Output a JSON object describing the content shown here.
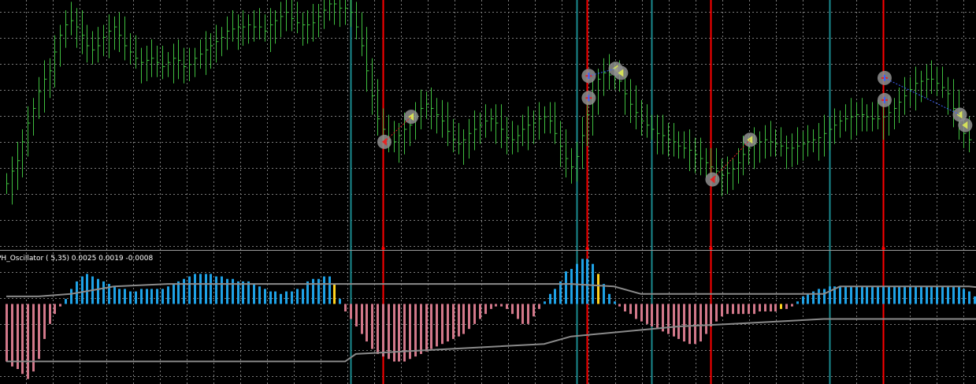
{
  "colors": {
    "background": "#000000",
    "grid": "#7a7a7a",
    "candle": "#3fbf3f",
    "vline_red": "#ff0000",
    "vline_cyan": "#1a8a8f",
    "hist_blue": "#1ea2e6",
    "hist_pink": "#d2788a",
    "hist_yellow": "#ffd21e",
    "signal_line": "#8a8a8a",
    "marker_fill": "#8f8f8f",
    "marker_red": "#e52525",
    "marker_blue": "#3a62ff",
    "marker_arrow": "#d4e05a"
  },
  "oscillator": {
    "label": "PH_Oscillator ( 5,35) 0.0025 0.0019 -0.0008"
  },
  "chart_data": [
    {
      "type": "candlestick",
      "panel": "price",
      "grid": true,
      "x_range": [
        0,
        184
      ],
      "y_range": [
        0,
        100
      ],
      "closes": [
        14,
        20,
        25,
        34,
        43,
        50,
        58,
        64,
        68,
        77,
        85,
        90,
        92,
        89,
        85,
        80,
        78,
        80,
        84,
        87,
        89,
        85,
        80,
        77,
        74,
        72,
        73,
        74,
        72,
        70,
        72,
        74,
        73,
        70,
        71,
        74,
        76,
        78,
        80,
        82,
        84,
        87,
        88,
        89,
        89,
        90,
        89,
        89,
        87,
        90,
        92,
        94,
        96,
        93,
        91,
        90,
        90,
        91,
        94,
        97,
        100,
        100,
        98,
        98,
        96,
        89,
        80,
        68,
        56,
        45,
        40,
        35,
        34,
        37,
        40,
        42,
        46,
        50,
        52,
        50,
        47,
        44,
        39,
        35,
        33,
        35,
        38,
        40,
        42,
        44,
        45,
        43,
        40,
        36,
        35,
        37,
        40,
        42,
        43,
        45,
        46,
        44,
        38,
        32,
        26,
        22,
        27,
        37,
        47,
        56,
        64,
        67,
        66,
        65,
        63,
        57,
        52,
        48,
        44,
        42,
        40,
        38,
        37,
        35,
        34,
        32,
        31,
        30,
        28,
        26,
        24,
        22,
        20,
        18,
        19,
        21,
        24,
        28,
        31,
        33,
        34,
        35,
        34,
        33,
        32,
        31,
        31,
        32,
        33,
        34,
        35,
        36,
        38,
        40,
        42,
        44,
        45,
        46,
        47,
        47,
        46,
        45,
        45,
        46,
        48,
        50,
        53,
        56,
        59,
        62,
        63,
        64,
        64,
        62,
        60,
        57,
        50,
        43,
        38,
        35
      ],
      "vertical_lines_red": [
        70,
        108,
        131,
        163
      ],
      "vertical_lines_cyan": [
        64,
        106,
        120,
        153
      ],
      "markers": [
        {
          "i": 70,
          "kind": "buy-circle"
        },
        {
          "i": 75,
          "kind": "close-arrow"
        },
        {
          "i": 108,
          "kind": "sell-cross"
        },
        {
          "i": 108,
          "kind": "sell-cross"
        },
        {
          "i": 113,
          "kind": "close-arrow"
        },
        {
          "i": 114,
          "kind": "close-arrow"
        },
        {
          "i": 131,
          "kind": "buy-circle"
        },
        {
          "i": 138,
          "kind": "close-arrow"
        },
        {
          "i": 163,
          "kind": "sell-cross"
        },
        {
          "i": 163,
          "kind": "sell-cross"
        },
        {
          "i": 177,
          "kind": "close-arrow"
        },
        {
          "i": 178,
          "kind": "close-arrow"
        }
      ]
    },
    {
      "type": "bar",
      "panel": "oscillator",
      "title": "PH_Oscillator ( 5,35) 0.0025 0.0019 -0.0008",
      "y_range": [
        -0.0032,
        0.002
      ],
      "x_range": [
        0,
        184
      ],
      "histogram": [
        -0.0023,
        -0.0025,
        -0.0026,
        -0.0028,
        -0.003,
        -0.0027,
        -0.0022,
        -0.0014,
        -0.0008,
        -0.0004,
        -0.0001,
        0.0002,
        0.0006,
        0.0009,
        0.0011,
        0.0012,
        0.0011,
        0.001,
        0.0009,
        0.0008,
        0.0007,
        0.0006,
        0.0006,
        0.0005,
        0.0005,
        0.0006,
        0.0006,
        0.0006,
        0.0006,
        0.0006,
        0.0007,
        0.0008,
        0.0009,
        0.001,
        0.0011,
        0.0012,
        0.0012,
        0.0012,
        0.0012,
        0.0011,
        0.0011,
        0.001,
        0.001,
        0.0009,
        0.0009,
        0.0009,
        0.0008,
        0.0007,
        0.0006,
        0.0005,
        0.0005,
        0.0004,
        0.0005,
        0.0005,
        0.0006,
        0.0006,
        0.0009,
        0.001,
        0.001,
        0.0011,
        0.0011,
        0.0008,
        0.0002,
        -0.0003,
        -0.0006,
        -0.0009,
        -0.0012,
        -0.0015,
        -0.0018,
        -0.002,
        -0.0021,
        -0.0022,
        -0.0023,
        -0.0023,
        -0.0023,
        -0.0022,
        -0.0021,
        -0.002,
        -0.0019,
        -0.0018,
        -0.0017,
        -0.0016,
        -0.0015,
        -0.0014,
        -0.0013,
        -0.0012,
        -0.001,
        -0.0008,
        -0.0006,
        -0.0004,
        -0.0002,
        -0.0001,
        -0.0001,
        -0.0002,
        -0.0004,
        -0.0006,
        -0.0008,
        -0.0008,
        -0.0005,
        -0.0002,
        0.0001,
        0.0004,
        0.0006,
        0.0009,
        0.0013,
        0.0014,
        0.0016,
        0.0018,
        0.0018,
        0.0016,
        0.0012,
        0.0008,
        0.0004,
        0.0001,
        -0.0001,
        -0.0003,
        -0.0004,
        -0.0006,
        -0.0007,
        -0.0008,
        -0.0009,
        -0.001,
        -0.0011,
        -0.0012,
        -0.0013,
        -0.0014,
        -0.0015,
        -0.0016,
        -0.0016,
        -0.0015,
        -0.0012,
        -0.0009,
        -0.0007,
        -0.0005,
        -0.0004,
        -0.0004,
        -0.0004,
        -0.0004,
        -0.0004,
        -0.0004,
        -0.0003,
        -0.0003,
        -0.0003,
        -0.0003,
        -0.0002,
        -0.0002,
        -0.0001,
        0.0001,
        0.0003,
        0.0004,
        0.0005,
        0.0006,
        0.0006,
        0.0007,
        0.0007,
        0.0007,
        0.0007,
        0.0007,
        0.0007,
        0.0007,
        0.0007,
        0.0007,
        0.0007,
        0.0007,
        0.0007,
        0.0007,
        0.0007,
        0.0007,
        0.0007,
        0.0007,
        0.0007,
        0.0007,
        0.0007,
        0.0007,
        0.0007,
        0.0007,
        0.0007,
        0.0007,
        0.0006,
        0.0005,
        0.0003,
        0.0001,
        0.0001
      ],
      "yellow_bars": [
        61,
        110,
        144
      ],
      "signal_upper": [
        {
          "i": 0,
          "v": 0.0003
        },
        {
          "i": 6,
          "v": 0.0003
        },
        {
          "i": 12,
          "v": 0.0004
        },
        {
          "i": 20,
          "v": 0.0007
        },
        {
          "i": 30,
          "v": 0.0008
        },
        {
          "i": 60,
          "v": 0.0008
        },
        {
          "i": 105,
          "v": 0.0008
        },
        {
          "i": 113,
          "v": 0.0007
        },
        {
          "i": 118,
          "v": 0.0004
        },
        {
          "i": 130,
          "v": 0.0004
        },
        {
          "i": 152,
          "v": 0.0004
        },
        {
          "i": 155,
          "v": 0.0007
        },
        {
          "i": 179,
          "v": 0.0007
        },
        {
          "i": 184,
          "v": 0.0006
        }
      ],
      "signal_lower": [
        {
          "i": 0,
          "v": -0.0023
        },
        {
          "i": 10,
          "v": -0.0023
        },
        {
          "i": 63,
          "v": -0.0023
        },
        {
          "i": 65,
          "v": -0.002
        },
        {
          "i": 100,
          "v": -0.0016
        },
        {
          "i": 105,
          "v": -0.0013
        },
        {
          "i": 125,
          "v": -0.0009
        },
        {
          "i": 135,
          "v": -0.0008
        },
        {
          "i": 152,
          "v": -0.0006
        },
        {
          "i": 155,
          "v": -0.0006
        },
        {
          "i": 184,
          "v": -0.0006
        }
      ]
    }
  ]
}
